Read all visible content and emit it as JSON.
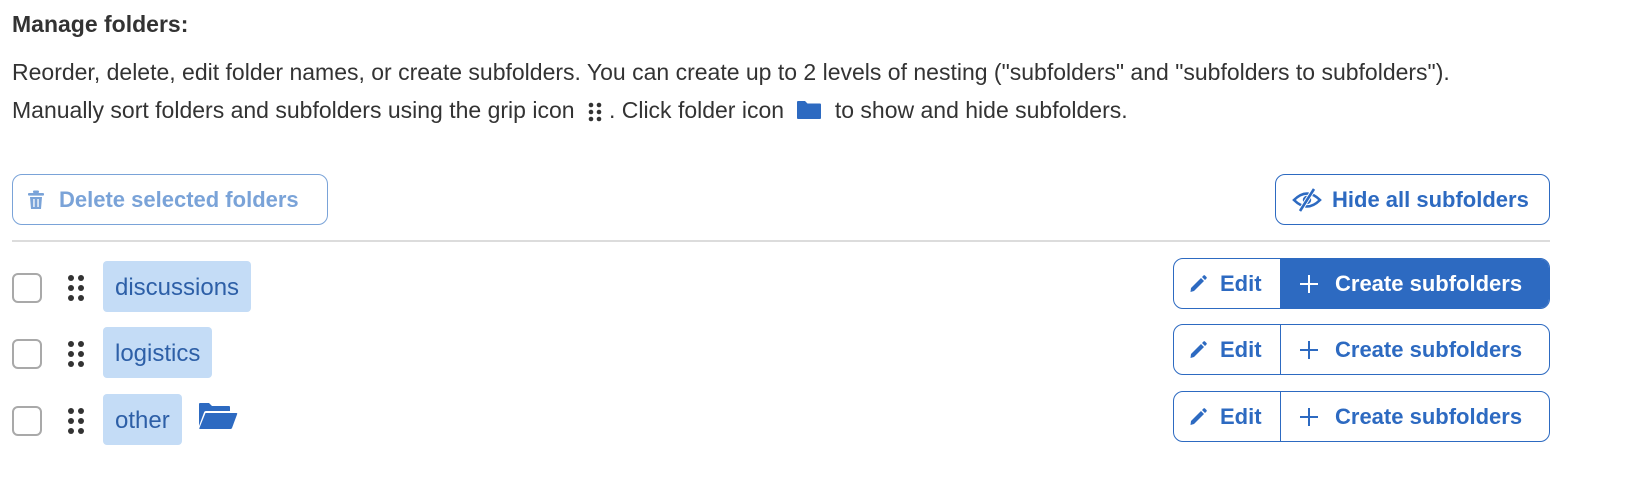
{
  "manage": {
    "heading": "Manage folders:",
    "description_part1": "Reorder, delete, edit folder names, or create subfolders. You can create up to 2 levels of nesting (\"subfolders\" and \"subfolders to subfolders\"). Manually sort folders and subfolders using the grip icon",
    "description_part2": ". Click folder icon",
    "description_part3": "to show and hide subfolders."
  },
  "toolbar": {
    "delete_label": "Delete selected folders",
    "hide_label": "Hide all subfolders"
  },
  "folders": [
    {
      "name": "discussions",
      "edit_label": "Edit",
      "create_label": "Create subfolders",
      "has_subfolders": false,
      "create_active": true
    },
    {
      "name": "logistics",
      "edit_label": "Edit",
      "create_label": "Create subfolders",
      "has_subfolders": false,
      "create_active": false
    },
    {
      "name": "other",
      "edit_label": "Edit",
      "create_label": "Create subfolders",
      "has_subfolders": true,
      "create_active": false
    }
  ],
  "icons": {
    "delete": "trash-icon",
    "hide": "eye-slash-icon",
    "grip": "grip-icon",
    "folder": "folder-icon",
    "folder_open": "folder-open-icon",
    "edit": "pencil-icon",
    "create": "plus-icon"
  },
  "colors": {
    "accent": "#2d6ac1",
    "accent_disabled": "#7aa3d8",
    "chip_bg": "#c4dcf6",
    "chip_text": "#2d5fa7",
    "divider": "#dcdcdc",
    "text": "#333333"
  }
}
